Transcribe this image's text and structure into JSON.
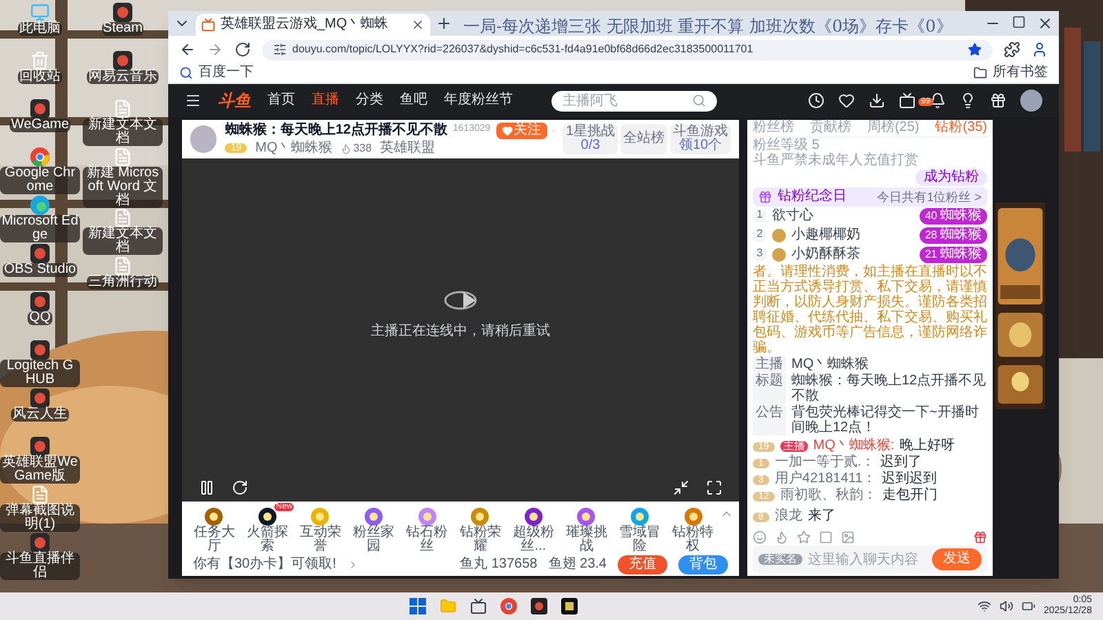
{
  "overlay_text": "一局-每次递增三张 无限加班 重开不算 加班次数《0场》存卡《0》",
  "desktop": {
    "columns": [
      [
        {
          "kind": "monitor",
          "label": "此电脑"
        },
        {
          "kind": "recycle",
          "label": "回收站"
        },
        {
          "kind": "app",
          "label": "WeGame"
        },
        {
          "kind": "chrome",
          "label": "Google Chrome"
        },
        {
          "kind": "edge",
          "label": "Microsoft Edge"
        },
        {
          "kind": "app",
          "label": "OBS Studio"
        },
        {
          "kind": "app",
          "label": "QQ"
        },
        {
          "kind": "app",
          "label": "Logitech G HUB"
        },
        {
          "kind": "app",
          "label": "风云人生"
        },
        {
          "kind": "app",
          "label": "英雄联盟WeGame版"
        },
        {
          "kind": "file",
          "label": "弹幕截图说明(1)"
        },
        {
          "kind": "app",
          "label": "斗鱼直播伴侣"
        }
      ],
      [
        {
          "kind": "app",
          "label": "Steam"
        },
        {
          "kind": "app",
          "label": "网易云音乐"
        },
        {
          "kind": "file",
          "label": "新建文本文档"
        },
        {
          "kind": "file",
          "label": "新建 Microsoft Word 文档"
        },
        {
          "kind": "file",
          "label": "新建文本文档"
        },
        {
          "kind": "file",
          "label": "三角洲行动"
        }
      ]
    ]
  },
  "browser": {
    "tab": {
      "title": "英雄联盟云游戏_MQ丶蜘蛛",
      "selected": true
    },
    "url": "douyu.com/topic/LOLYYX?rid=226037&dyshid=c6c531-fd4a91e0bf68d66d2ec3183500011701",
    "bookmarks": [
      {
        "label": "百度一下"
      }
    ],
    "all_bookmarks": "所有书签"
  },
  "site": {
    "logo": "斗鱼",
    "nav": [
      {
        "label": "首页",
        "selected": false
      },
      {
        "label": "直播",
        "selected": true
      },
      {
        "label": "分类",
        "selected": false
      },
      {
        "label": "鱼吧",
        "selected": false
      },
      {
        "label": "年度粉丝节",
        "selected": false
      }
    ],
    "search": {
      "placeholder": "主播阿飞"
    },
    "notification_count": "99"
  },
  "stream": {
    "title": "蜘蛛猴：每天晚上12点开播不见不散",
    "room_id": "1613029",
    "follow": "关注",
    "level": "19",
    "streamer": "MQ丶蜘蛛猴",
    "popularity": "338",
    "category": "英雄联盟",
    "stats": [
      {
        "label": "1星挑战",
        "value": "0/3"
      },
      {
        "label": "全站榜"
      },
      {
        "label": "斗鱼游戏",
        "value": "领10个"
      }
    ],
    "video_message": "主播正在连线中，请稍后重试"
  },
  "gifts": [
    {
      "label": "任务大厅"
    },
    {
      "label": "火箭探索",
      "badge": "New"
    },
    {
      "label": "互动荣誉"
    },
    {
      "label": "粉丝家园"
    },
    {
      "label": "钻石粉丝"
    },
    {
      "label": "钻粉荣耀"
    },
    {
      "label": "超级粉丝..."
    },
    {
      "label": "璀璨挑战"
    },
    {
      "label": "雪域冒险"
    },
    {
      "label": "钻粉特权"
    }
  ],
  "footer": {
    "promo": "你有【30办卡】可领取!",
    "fish_balls": "鱼丸 137658",
    "fish_fins": "鱼翅 23.4",
    "recharge": "充值",
    "backpack": "背包"
  },
  "chat": {
    "tabs": [
      {
        "label": "粉丝榜",
        "selected": false
      },
      {
        "label": "贡献榜",
        "selected": false
      },
      {
        "label": "周榜(25)",
        "selected": false
      },
      {
        "label": "钻粉(35)",
        "selected": true
      }
    ],
    "fan_level": "粉丝等级 5",
    "minor_notice": "斗鱼严禁未成年人充值打赏",
    "become_fan": "成为钻粉",
    "anniversary": {
      "title": "钻粉纪念日",
      "summary": "今日共有1位粉丝 >"
    },
    "fans": [
      {
        "rank": "1",
        "name": "欲寸心",
        "level": "40",
        "badge": "蜘蛛猴",
        "avatar": false
      },
      {
        "rank": "2",
        "name": "小趣椰椰奶",
        "level": "28",
        "badge": "蜘蛛猴",
        "avatar": true
      },
      {
        "rank": "3",
        "name": "小奶酥酥茶",
        "level": "21",
        "badge": "蜘蛛猴",
        "avatar": true
      }
    ],
    "warning": "者。请理性消费，如主播在直播时以不正当方式诱导打赏、私下交易，请谨慎判断，以防人身财产损失。谨防各类招聘征婚、代练代抽、私下交易、购买礼包码、游戏币等广告信息，谨防网络诈骗。",
    "info": [
      {
        "label": "主播",
        "text": "MQ丶蜘蛛猴"
      },
      {
        "label": "标题",
        "text": "蜘蛛猴：每天晚上12点开播不见不散"
      },
      {
        "label": "公告",
        "text": "背包荧光棒记得交一下~开播时间晚上12点！"
      }
    ],
    "messages": [
      {
        "kind": "host",
        "level": "19",
        "role": "主播",
        "user": "MQ丶蜘蛛猴:",
        "text": "晚上好呀"
      },
      {
        "kind": "chat",
        "level": "1",
        "user": "一加一等于贰.：",
        "text": "迟到了"
      },
      {
        "kind": "chat",
        "level": "3",
        "user": "用户42181411：",
        "text": "迟到迟到"
      },
      {
        "kind": "chat",
        "level": "12",
        "user": "雨初歌、秋韵：",
        "text": "走包开门"
      },
      {
        "kind": "enter",
        "level": "8",
        "user": "浪龙",
        "text": "来了"
      }
    ],
    "input": {
      "placeholder": "这里输入聊天内容",
      "badge": "未实名",
      "send": "发送"
    }
  },
  "taskbar": {
    "time": "0:05",
    "date": "2025/12/28"
  }
}
